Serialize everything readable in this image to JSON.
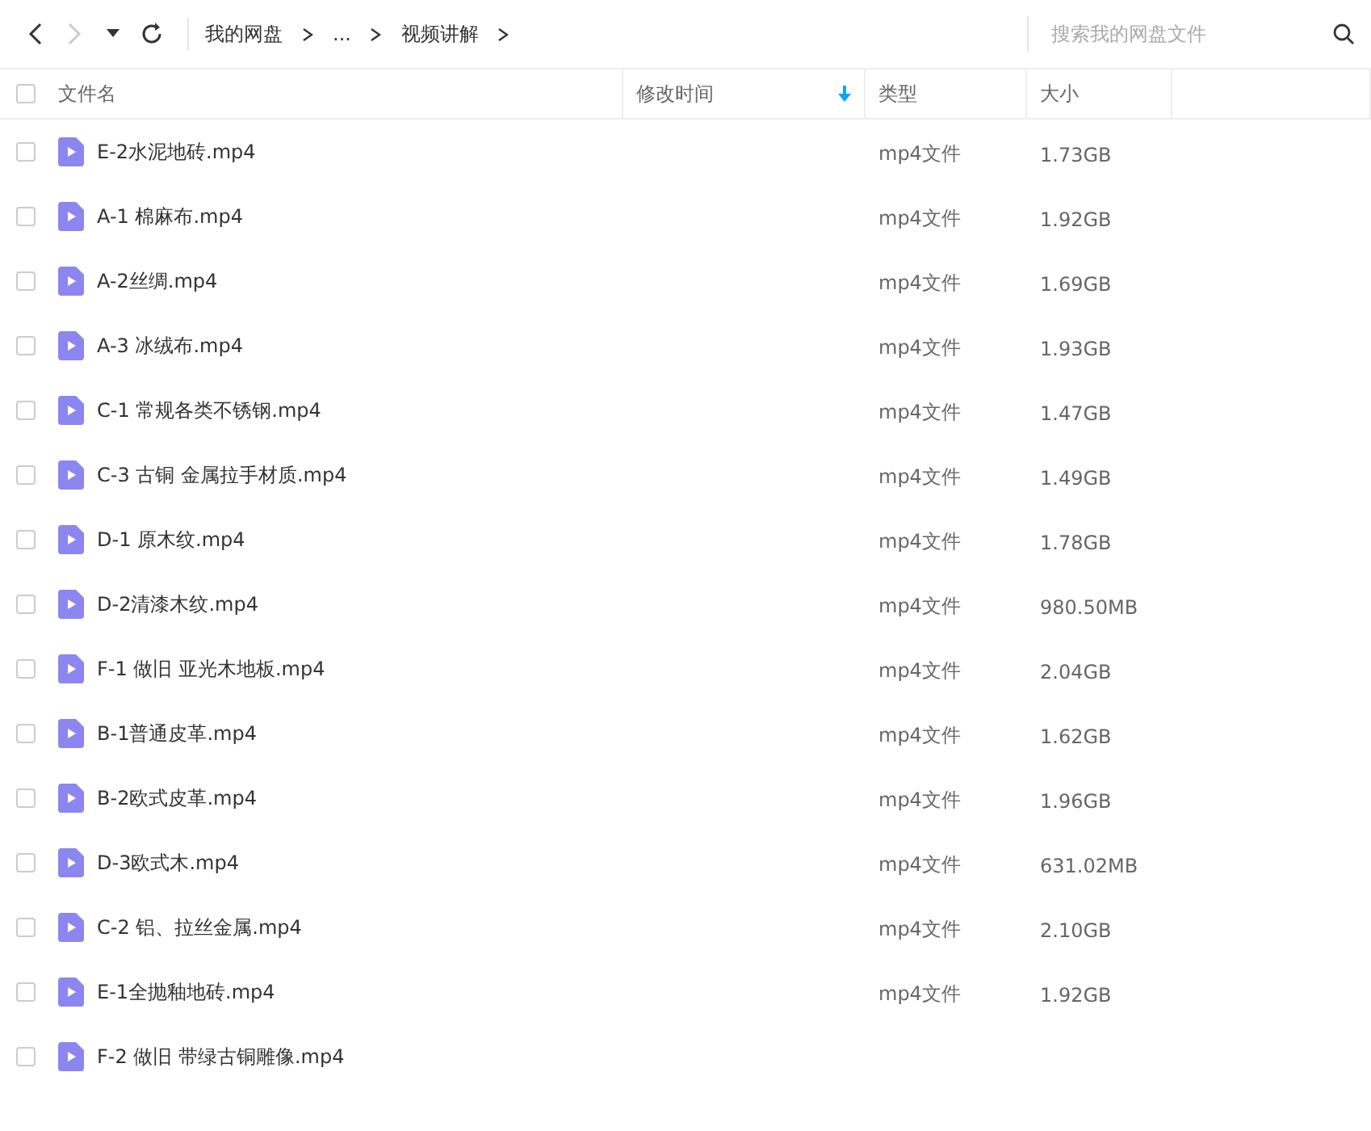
{
  "toolbar": {
    "breadcrumbs": [
      {
        "label": "我的网盘"
      },
      {
        "label": "..."
      },
      {
        "label": "视频讲解"
      }
    ],
    "search": {
      "placeholder": "搜索我的网盘文件"
    }
  },
  "table": {
    "select_all": {
      "checked": false
    },
    "columns": [
      {
        "label": "文件名",
        "sorted": false
      },
      {
        "label": "修改时间",
        "sorted": true
      },
      {
        "label": "类型",
        "sorted": false
      },
      {
        "label": "大小",
        "sorted": false
      }
    ],
    "rows": [
      {
        "name": "E-2水泥地砖.mp4",
        "type": "mp4文件",
        "size": "1.73GB",
        "checked": false
      },
      {
        "name": "A-1 棉麻布.mp4",
        "type": "mp4文件",
        "size": "1.92GB",
        "checked": false
      },
      {
        "name": "A-2丝绸.mp4",
        "type": "mp4文件",
        "size": "1.69GB",
        "checked": false
      },
      {
        "name": "A-3 冰绒布.mp4",
        "type": "mp4文件",
        "size": "1.93GB",
        "checked": false
      },
      {
        "name": "C-1 常规各类不锈钢.mp4",
        "type": "mp4文件",
        "size": "1.47GB",
        "checked": false
      },
      {
        "name": "C-3 古铜 金属拉手材质.mp4",
        "type": "mp4文件",
        "size": "1.49GB",
        "checked": false
      },
      {
        "name": "D-1 原木纹.mp4",
        "type": "mp4文件",
        "size": "1.78GB",
        "checked": false
      },
      {
        "name": "D-2清漆木纹.mp4",
        "type": "mp4文件",
        "size": "980.50MB",
        "checked": false
      },
      {
        "name": "F-1 做旧 亚光木地板.mp4",
        "type": "mp4文件",
        "size": "2.04GB",
        "checked": false
      },
      {
        "name": "B-1普通皮革.mp4",
        "type": "mp4文件",
        "size": "1.62GB",
        "checked": false
      },
      {
        "name": "B-2欧式皮革.mp4",
        "type": "mp4文件",
        "size": "1.96GB",
        "checked": false
      },
      {
        "name": "D-3欧式木.mp4",
        "type": "mp4文件",
        "size": "631.02MB",
        "checked": false
      },
      {
        "name": "C-2 铝、拉丝金属.mp4",
        "type": "mp4文件",
        "size": "2.10GB",
        "checked": false
      },
      {
        "name": "E-1全抛釉地砖.mp4",
        "type": "mp4文件",
        "size": "1.92GB",
        "checked": false
      },
      {
        "name": "F-2 做旧 带绿古铜雕像.mp4",
        "checked": false
      }
    ]
  }
}
